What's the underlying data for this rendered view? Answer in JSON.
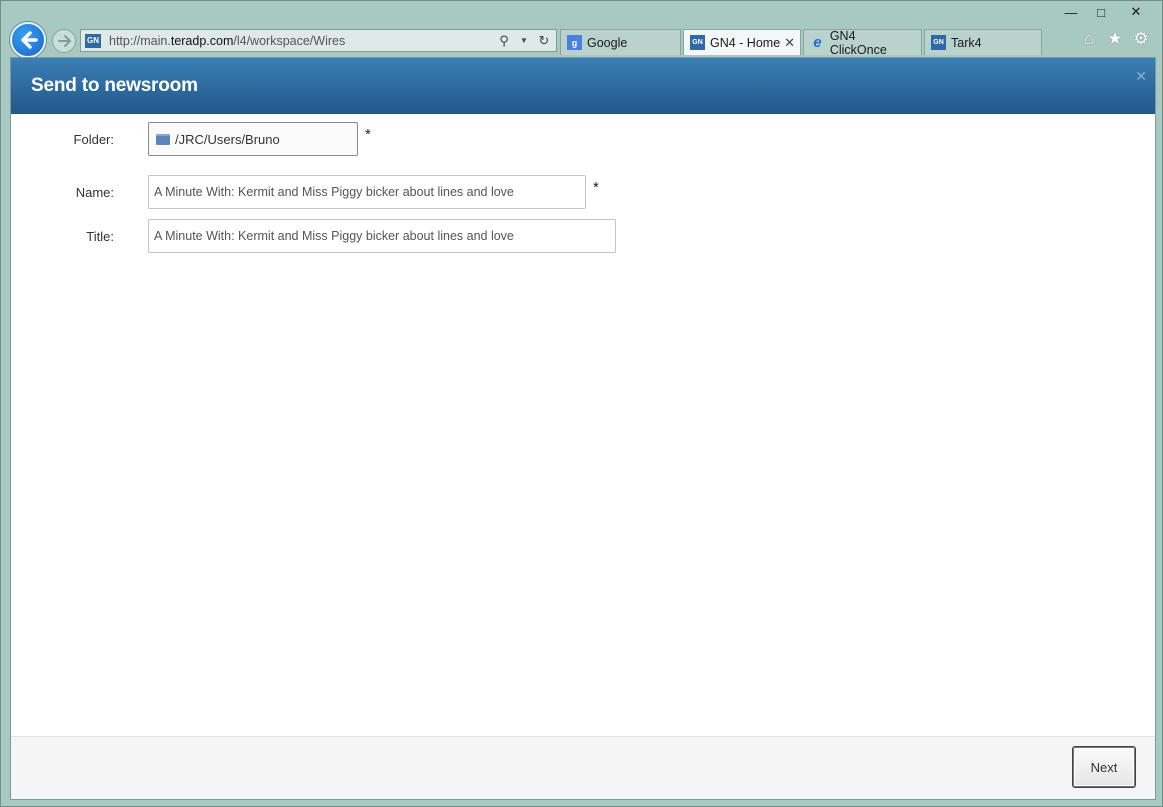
{
  "browser": {
    "url_prefix": "http://main.",
    "url_domain": "teradp.com",
    "url_path": "/l4/workspace/Wires",
    "site_favicon": "GN",
    "tabs": [
      {
        "label": "Google",
        "icon": "google-icon",
        "icon_text": "g",
        "icon_color": "#4a7ee0",
        "active": false
      },
      {
        "label": "GN4 - Home",
        "icon": "gn4-icon",
        "icon_text": "GN",
        "icon_color": "#2f6aa6",
        "active": true
      },
      {
        "label": "GN4 ClickOnce",
        "icon": "internet-explorer-icon",
        "icon_text": "e",
        "icon_color": "#e9a020",
        "active": false
      },
      {
        "label": "Tark4",
        "icon": "gn4-icon",
        "icon_text": "GN",
        "icon_color": "#2f6aa6",
        "active": false
      }
    ]
  },
  "dialog": {
    "title": "Send to newsroom",
    "folder": {
      "label": "Folder:",
      "value": "/JRC/Users/Bruno",
      "required": "*"
    },
    "name": {
      "label": "Name:",
      "value": "A Minute With: Kermit and Miss Piggy bicker about lines and love",
      "required": "*"
    },
    "title_field": {
      "label": "Title:",
      "value": "A Minute With: Kermit and Miss Piggy bicker about lines and love"
    },
    "next_label": "Next"
  },
  "colors": {
    "header_top": "#3a7fb5",
    "header_bottom": "#23578a",
    "frame": "#a8c8c2"
  }
}
